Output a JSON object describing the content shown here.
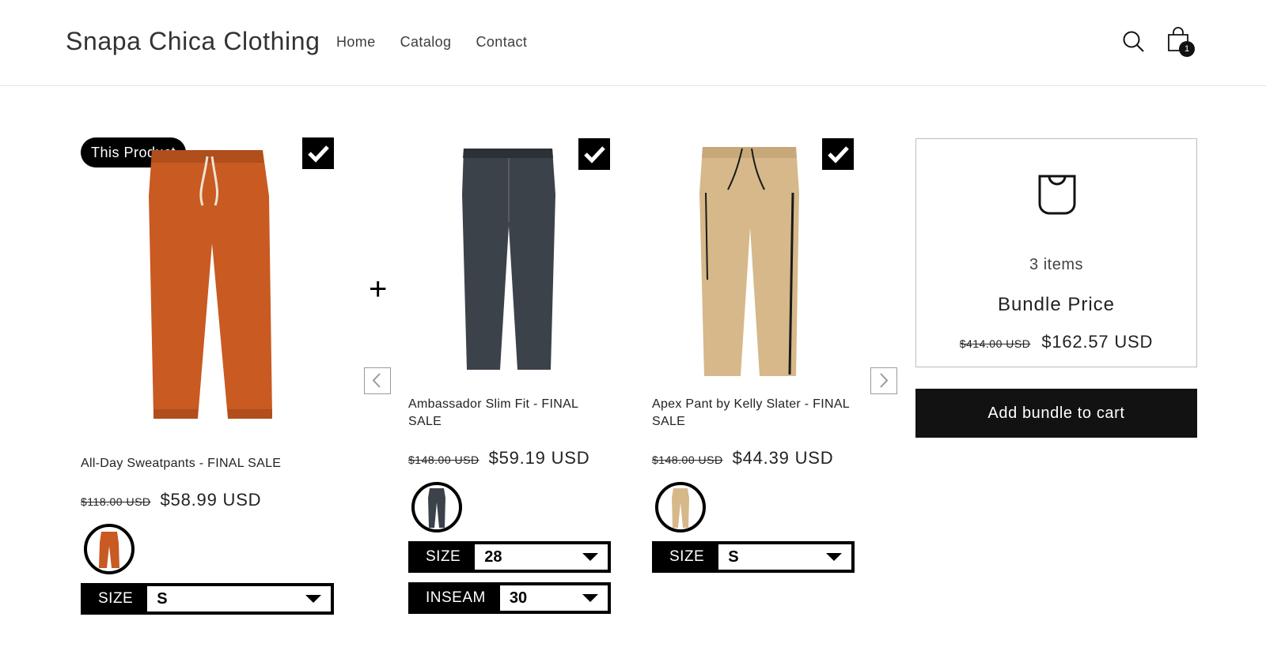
{
  "header": {
    "brand": "Snapa Chica Clothing",
    "nav": [
      "Home",
      "Catalog",
      "Contact"
    ],
    "cart_count": "1"
  },
  "bundle_products": [
    {
      "badge": "This Product",
      "title": "All-Day Sweatpants - FINAL SALE",
      "old_price": "$118.00 USD",
      "price": "$58.99 USD",
      "color": "#c85a22",
      "options": [
        {
          "label": "SIZE",
          "value": "S"
        }
      ]
    },
    {
      "title": "Ambassador Slim Fit - FINAL SALE",
      "old_price": "$148.00 USD",
      "price": "$59.19 USD",
      "color": "#3c4249",
      "options": [
        {
          "label": "SIZE",
          "value": "28"
        },
        {
          "label": "INSEAM",
          "value": "30"
        }
      ]
    },
    {
      "title": "Apex Pant by Kelly Slater - FINAL SALE",
      "old_price": "$148.00 USD",
      "price": "$44.39 USD",
      "color": "#d6b88a",
      "options": [
        {
          "label": "SIZE",
          "value": "S"
        }
      ]
    }
  ],
  "bundle": {
    "items": "3 items",
    "label": "Bundle Price",
    "old_price": "$414.00 USD",
    "price": "$162.57 USD",
    "button": "Add bundle to cart"
  },
  "plus_symbol": "+"
}
